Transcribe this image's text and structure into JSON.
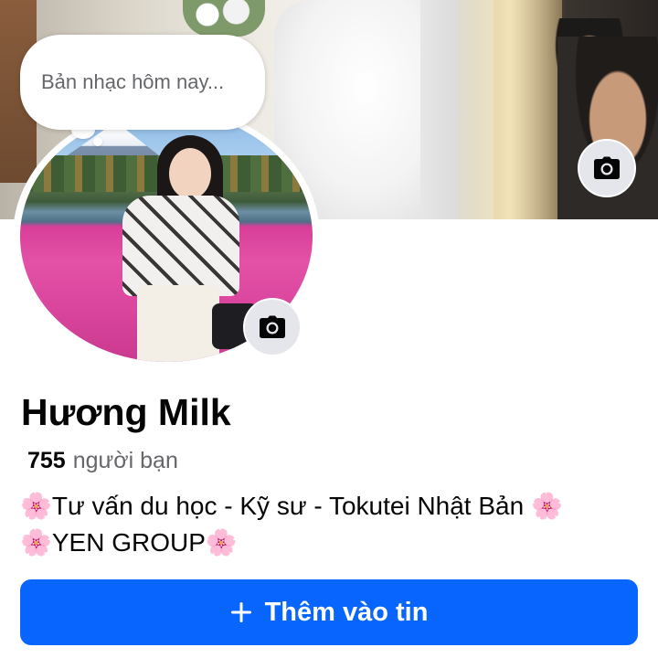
{
  "note": {
    "placeholder": "Bản nhạc hôm nay..."
  },
  "profile": {
    "name": "Hương Milk",
    "friends_count": "755",
    "friends_label": "người bạn",
    "bio_line1": "🌸Tư vấn du học - Kỹ sư - Tokutei Nhật Bản 🌸",
    "bio_line2": "🌸YEN GROUP🌸"
  },
  "actions": {
    "add_story_icon": "plus-icon",
    "add_story_label": "Thêm vào tin"
  },
  "icons": {
    "cover_camera": "camera-icon",
    "avatar_camera": "camera-icon"
  },
  "colors": {
    "primary_button": "#0866ff",
    "camera_button_bg": "#e4e6eb",
    "secondary_text": "#65676b"
  }
}
